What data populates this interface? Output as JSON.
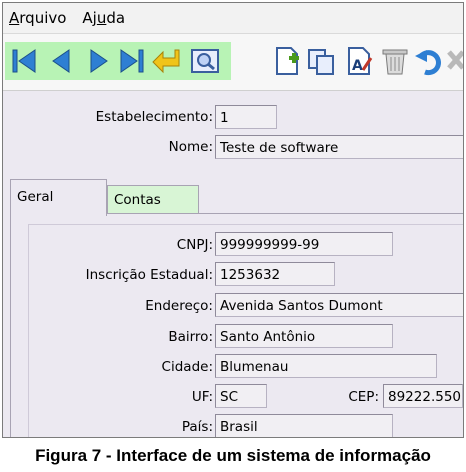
{
  "menu": {
    "arquivo": {
      "first": "A",
      "rest": "rquivo"
    },
    "ajuda": {
      "first": "Aj",
      "u": "u",
      "rest": "da"
    }
  },
  "toolbar": {
    "icons": [
      "first-record-icon",
      "previous-record-icon",
      "next-record-icon",
      "last-record-icon",
      "return-icon",
      "preview-icon",
      "new-document-icon",
      "copy-icon",
      "edit-text-icon",
      "delete-icon",
      "undo-icon",
      "close-icon"
    ],
    "colors": {
      "nav_bg": "#b8f3b5",
      "blue": "#2e7fd3",
      "green": "#4a9a1c"
    }
  },
  "header": {
    "estabelecimento_label": "Estabelecimento:",
    "estabelecimento_value": "1",
    "nome_label": "Nome:",
    "nome_value": "Teste de software"
  },
  "tabs": {
    "geral": "Geral",
    "contas": "Contas"
  },
  "form": {
    "cnpj_label": "CNPJ:",
    "cnpj_value": "999999999-99",
    "ie_label": "Inscrição Estadual:",
    "ie_value": "1253632",
    "endereco_label": "Endereço:",
    "endereco_value": "Avenida Santos Dumont",
    "bairro_label": "Bairro:",
    "bairro_value": "Santo Antônio",
    "cidade_label": "Cidade:",
    "cidade_value": "Blumenau",
    "uf_label": "UF:",
    "uf_value": "SC",
    "cep_label": "CEP:",
    "cep_value": "89222.550",
    "pais_label": "País:",
    "pais_value": "Brasil"
  },
  "caption": "Figura 7 - Interface de um sistema de informação"
}
